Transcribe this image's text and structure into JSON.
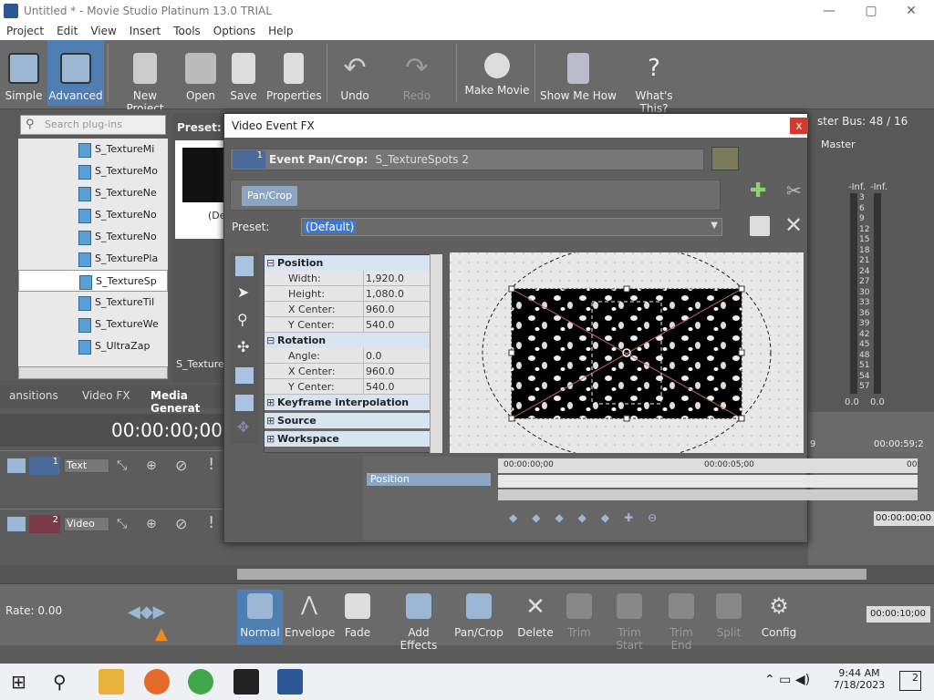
{
  "app": {
    "title": "Untitled * - Movie Studio Platinum 13.0 TRIAL",
    "window_controls": [
      "—",
      "▢",
      "✕"
    ]
  },
  "menu": [
    "Project",
    "Edit",
    "View",
    "Insert",
    "Tools",
    "Options",
    "Help"
  ],
  "toolbar": {
    "simple": "Simple",
    "advanced": "Advanced",
    "new_project": "New Project",
    "open": "Open",
    "save": "Save",
    "properties": "Properties",
    "undo": "Undo",
    "redo": "Redo",
    "make_movie": "Make Movie",
    "show_me_how": "Show Me How",
    "whats_this": "What's This?"
  },
  "left_panel": {
    "search_placeholder": "Search plug-ins",
    "plugins": [
      "S_TextureMi",
      "S_TextureMo",
      "S_TextureNe",
      "S_TextureNo",
      "S_TextureNo",
      "S_TexturePla",
      "S_TextureSp",
      "S_TextureTil",
      "S_TextureWe",
      "S_UltraZap"
    ],
    "selected_index": 6,
    "tabs": [
      "ansitions",
      "Video FX",
      "Media Generat"
    ],
    "preset_label": "Preset:",
    "preset_thumb_caption": "(De",
    "preset_footer": "S_TextureS"
  },
  "timeline": {
    "timecode": "00:00:00;00",
    "tracks": [
      {
        "num": "1",
        "name": "Text"
      },
      {
        "num": "2",
        "name": "Video"
      }
    ]
  },
  "master": {
    "title": "ster Bus: 48 / 16",
    "label": "Master",
    "inf_left": "-Inf.",
    "inf_right": "-Inf.",
    "scale": [
      "3",
      "6",
      "9",
      "12",
      "15",
      "18",
      "21",
      "24",
      "27",
      "30",
      "33",
      "36",
      "39",
      "42",
      "45",
      "48",
      "51",
      "54",
      "57"
    ],
    "bottom_left": "0.0",
    "bottom_right": "0.0"
  },
  "right_timeline": {
    "ruler_a": "9",
    "ruler_b": "00:00:59;2",
    "end_time": "00:00:10;00"
  },
  "dialog": {
    "title": "Video Event FX",
    "close": "x",
    "chain_num": "1",
    "chain_label": "Event Pan/Crop:",
    "chain_value": "S_TextureSpots 2",
    "tab": "Pan/Crop",
    "preset_label": "Preset:",
    "preset_value": "(Default)",
    "props": {
      "position": "Position",
      "width_k": "Width:",
      "width_v": "1,920.0",
      "height_k": "Height:",
      "height_v": "1,080.0",
      "xc_k": "X Center:",
      "xc_v": "960.0",
      "yc_k": "Y Center:",
      "yc_v": "540.0",
      "rotation": "Rotation",
      "angle_k": "Angle:",
      "angle_v": "0.0",
      "rxc_k": "X Center:",
      "rxc_v": "960.0",
      "ryc_k": "Y Center:",
      "ryc_v": "540.0",
      "keyframe": "Keyframe interpolation",
      "source": "Source",
      "workspace": "Workspace"
    },
    "kf_track": "Position",
    "kf_time_start": "00:00:00;00",
    "kf_time_mid": "00:00:05;00",
    "kf_time_end": "00:",
    "kf_current": "00:00:00;00"
  },
  "bottom": {
    "rate": "Rate: 0.00",
    "normal": "Normal",
    "envelope": "Envelope",
    "fade": "Fade",
    "add_effects": "Add Effects",
    "pan_crop": "Pan/Crop",
    "delete": "Delete",
    "trim": "Trim",
    "trim_start": "Trim Start",
    "trim_end": "Trim End",
    "split": "Split",
    "config": "Config"
  },
  "taskbar": {
    "time": "9:44 AM",
    "date": "7/18/2023",
    "notif": "2"
  }
}
